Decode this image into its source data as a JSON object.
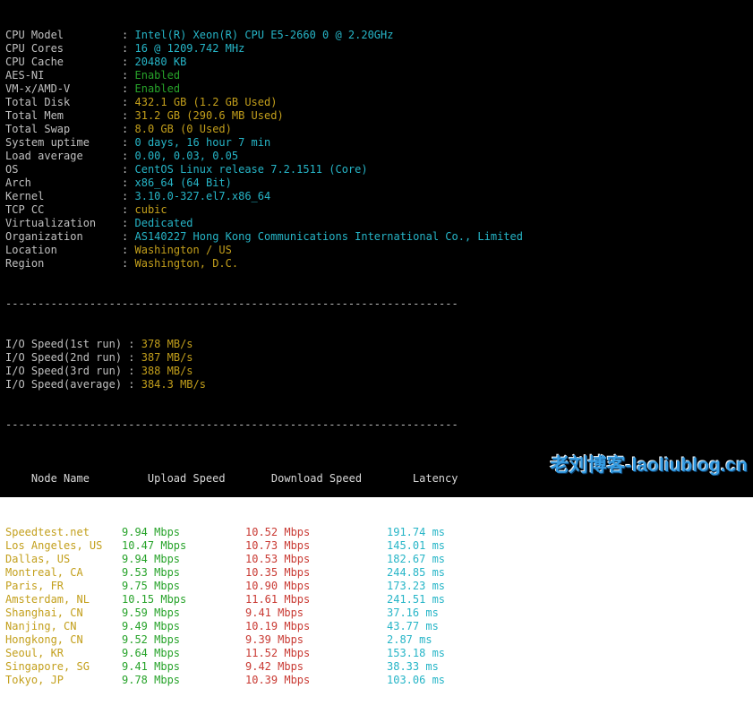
{
  "info_key_width": 18,
  "info": [
    {
      "label": "CPU Model",
      "value": "Intel(R) Xeon(R) CPU E5-2660 0 @ 2.20GHz",
      "cls": "cyan"
    },
    {
      "label": "CPU Cores",
      "value": "16 @ 1209.742 MHz",
      "cls": "cyan"
    },
    {
      "label": "CPU Cache",
      "value": "20480 KB",
      "cls": "cyan"
    },
    {
      "label": "AES-NI",
      "value": "Enabled",
      "cls": "green"
    },
    {
      "label": "VM-x/AMD-V",
      "value": "Enabled",
      "cls": "green"
    },
    {
      "label": "Total Disk",
      "value": "432.1 GB (1.2 GB Used)",
      "cls": "yellow"
    },
    {
      "label": "Total Mem",
      "value": "31.2 GB (290.6 MB Used)",
      "cls": "yellow"
    },
    {
      "label": "Total Swap",
      "value": "8.0 GB (0 Used)",
      "cls": "yellow"
    },
    {
      "label": "System uptime",
      "value": "0 days, 16 hour 7 min",
      "cls": "cyan"
    },
    {
      "label": "Load average",
      "value": "0.00, 0.03, 0.05",
      "cls": "cyan"
    },
    {
      "label": "OS",
      "value": "CentOS Linux release 7.2.1511 (Core)",
      "cls": "cyan"
    },
    {
      "label": "Arch",
      "value": "x86_64 (64 Bit)",
      "cls": "cyan"
    },
    {
      "label": "Kernel",
      "value": "3.10.0-327.el7.x86_64",
      "cls": "cyan"
    },
    {
      "label": "TCP CC",
      "value": "cubic",
      "cls": "yellow"
    },
    {
      "label": "Virtualization",
      "value": "Dedicated",
      "cls": "cyan"
    },
    {
      "label": "Organization",
      "value": "AS140227 Hong Kong Communications International Co., Limited",
      "cls": "cyan"
    },
    {
      "label": "Location",
      "value": "Washington / US",
      "cls": "yellow"
    },
    {
      "label": "Region",
      "value": "Washington, D.C.",
      "cls": "yellow"
    }
  ],
  "io": [
    {
      "label": "I/O Speed(1st run) ",
      "value": "378 MB/s"
    },
    {
      "label": "I/O Speed(2nd run) ",
      "value": "387 MB/s"
    },
    {
      "label": "I/O Speed(3rd run) ",
      "value": "388 MB/s"
    },
    {
      "label": "I/O Speed(average) ",
      "value": "384.3 MB/s"
    }
  ],
  "table": {
    "header": {
      "node": "Node Name",
      "upload": "Upload Speed",
      "download": "Download Speed",
      "latency": "Latency"
    },
    "rows": [
      {
        "node": "Speedtest.net",
        "upload": "9.94 Mbps",
        "download": "10.52 Mbps",
        "latency": "191.74 ms"
      },
      {
        "node": "Los Angeles, US",
        "upload": "10.47 Mbps",
        "download": "10.73 Mbps",
        "latency": "145.01 ms"
      },
      {
        "node": "Dallas, US",
        "upload": "9.94 Mbps",
        "download": "10.53 Mbps",
        "latency": "182.67 ms"
      },
      {
        "node": "Montreal, CA",
        "upload": "9.53 Mbps",
        "download": "10.35 Mbps",
        "latency": "244.85 ms"
      },
      {
        "node": "Paris, FR",
        "upload": "9.75 Mbps",
        "download": "10.90 Mbps",
        "latency": "173.23 ms"
      },
      {
        "node": "Amsterdam, NL",
        "upload": "10.15 Mbps",
        "download": "11.61 Mbps",
        "latency": "241.51 ms"
      },
      {
        "node": "Shanghai, CN",
        "upload": "9.59 Mbps",
        "download": "9.41 Mbps",
        "latency": "37.16 ms"
      },
      {
        "node": "Nanjing, CN",
        "upload": "9.49 Mbps",
        "download": "10.19 Mbps",
        "latency": "43.77 ms"
      },
      {
        "node": "Hongkong, CN",
        "upload": "9.52 Mbps",
        "download": "9.39 Mbps",
        "latency": "2.87 ms"
      },
      {
        "node": "Seoul, KR",
        "upload": "9.64 Mbps",
        "download": "11.52 Mbps",
        "latency": "153.18 ms"
      },
      {
        "node": "Singapore, SG",
        "upload": "9.41 Mbps",
        "download": "9.42 Mbps",
        "latency": "38.33 ms"
      },
      {
        "node": "Tokyo, JP",
        "upload": "9.78 Mbps",
        "download": "10.39 Mbps",
        "latency": "103.06 ms"
      }
    ]
  },
  "dash": "----------------------------------------------------------------------",
  "watermark": "老刘博客-laoliublog.cn"
}
